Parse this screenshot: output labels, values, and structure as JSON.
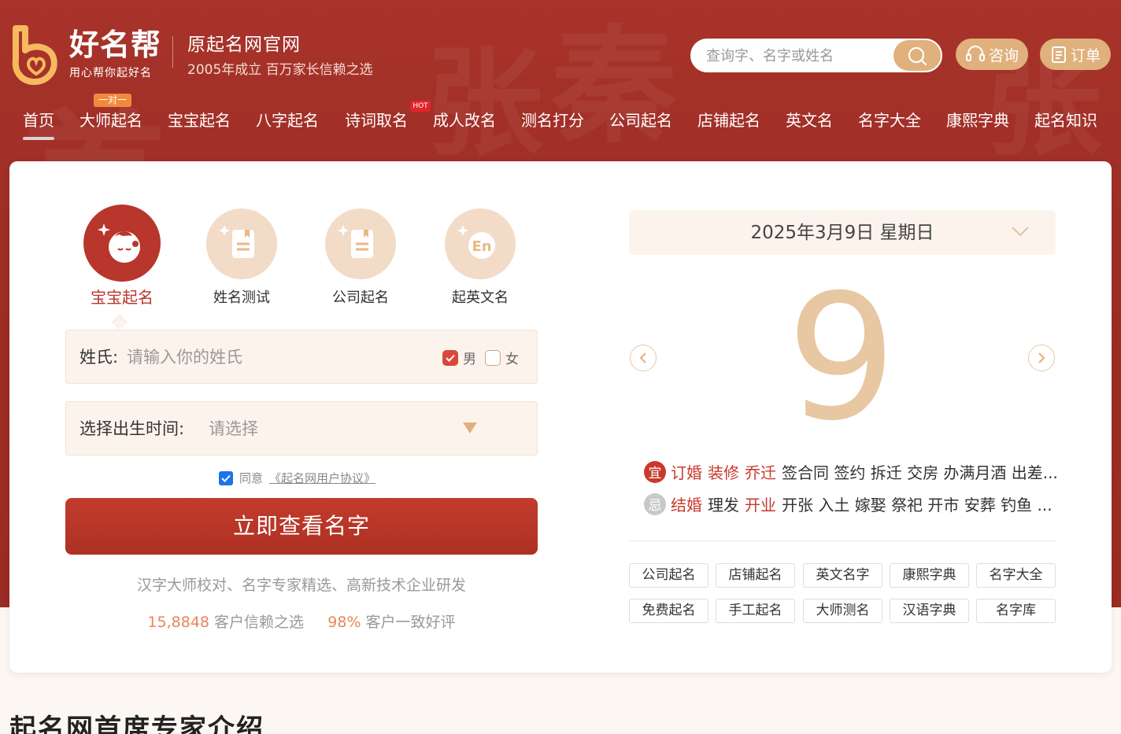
{
  "header": {
    "brand_name": "好名帮",
    "brand_slogan": "用心帮你起好名",
    "site_title": "原起名网官网",
    "site_subtitle": "2005年成立 百万家长信赖之选",
    "search_placeholder": "查询字、名字或姓名",
    "consult_label": "咨询",
    "order_label": "订单"
  },
  "nav": {
    "items": [
      "首页",
      "大师起名",
      "宝宝起名",
      "八字起名",
      "诗词取名",
      "成人改名",
      "测名打分",
      "公司起名",
      "店铺起名",
      "英文名",
      "名字大全",
      "康熙字典",
      "起名知识"
    ],
    "badge_duiyi": "一对一",
    "badge_hot": "HOT"
  },
  "categories": [
    {
      "label": "宝宝起名",
      "icon": "baby-face-icon"
    },
    {
      "label": "姓名测试",
      "icon": "notebook-icon"
    },
    {
      "label": "公司起名",
      "icon": "notebook-icon"
    },
    {
      "label": "起英文名",
      "icon": "en-icon"
    }
  ],
  "form": {
    "surname_label": "姓氏:",
    "surname_placeholder": "请输入你的姓氏",
    "male_label": "男",
    "female_label": "女",
    "birth_label": "选择出生时间:",
    "birth_placeholder": "请选择",
    "agree_prefix": "同意",
    "agree_link": "《起名网用户协议》",
    "submit_label": "立即查看名字",
    "tagline": "汉字大师校对、名字专家精选、高新技术企业研发",
    "stat1_num": "15,8848",
    "stat1_text": "客户信赖之选",
    "stat2_num": "98%",
    "stat2_text": "客户一致好评"
  },
  "calendar": {
    "date_text": "2025年3月9日 星期日",
    "day": "9",
    "yi_mark": "宜",
    "ji_mark": "忌",
    "yi_highlight": [
      "订婚",
      "装修",
      "乔迁"
    ],
    "yi_rest": "签合同 签约 拆迁 交房 办满月酒 出差...",
    "ji_highlight1": "结婚",
    "ji_mid": "理发",
    "ji_highlight2": "开业",
    "ji_rest": "开张 入土 嫁娶 祭祀 开市 安葬 钓鱼 ..."
  },
  "tags": [
    "公司起名",
    "店铺起名",
    "英文名字",
    "康熙字典",
    "名字大全",
    "免费起名",
    "手工起名",
    "大师测名",
    "汉语字典",
    "名字库"
  ],
  "section_title": "起名网首席专家介绍",
  "colors": {
    "brand_red": "#9d2e26",
    "gold": "#e0b07d",
    "accent_red": "#c9392c"
  }
}
